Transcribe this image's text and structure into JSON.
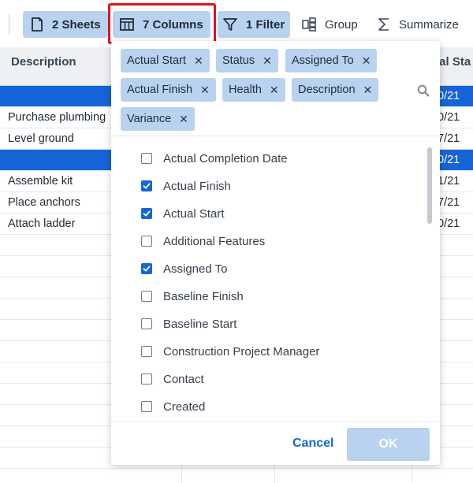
{
  "toolbar": {
    "sheets_label": "2 Sheets",
    "columns_label": "7 Columns",
    "filter_label": "1 Filter",
    "group_label": "Group",
    "summarize_label": "Summarize"
  },
  "grid": {
    "header_description": "Description",
    "header_right": "ual Sta",
    "rows": [
      {
        "desc": "",
        "right": "0/21",
        "selected": true
      },
      {
        "desc": "Purchase plumbing",
        "right": "0/21",
        "selected": false
      },
      {
        "desc": "Level ground",
        "right": "7/21",
        "selected": false
      },
      {
        "desc": "",
        "right": "0/21",
        "selected": true
      },
      {
        "desc": "Assemble kit",
        "right": "1/21",
        "selected": false
      },
      {
        "desc": "Place anchors",
        "right": "7/21",
        "selected": false
      },
      {
        "desc": "Attach ladder",
        "right": "0/21",
        "selected": false
      }
    ]
  },
  "panel": {
    "chips": [
      "Actual Start",
      "Status",
      "Assigned To",
      "Actual Finish",
      "Health",
      "Description",
      "Variance"
    ],
    "items": [
      {
        "label": "Actual Completion Date",
        "checked": false
      },
      {
        "label": "Actual Finish",
        "checked": true
      },
      {
        "label": "Actual Start",
        "checked": true
      },
      {
        "label": "Additional Features",
        "checked": false
      },
      {
        "label": "Assigned To",
        "checked": true
      },
      {
        "label": "Baseline Finish",
        "checked": false
      },
      {
        "label": "Baseline Start",
        "checked": false
      },
      {
        "label": "Construction Project Manager",
        "checked": false
      },
      {
        "label": "Contact",
        "checked": false
      },
      {
        "label": "Created",
        "checked": false
      }
    ],
    "cancel_label": "Cancel",
    "ok_label": "OK"
  },
  "colors": {
    "accent": "#1565d8",
    "chip_bg": "#b9d2ef",
    "highlight": "#e0141e"
  },
  "icons": [
    "sheet-icon",
    "columns-icon",
    "filter-icon",
    "group-icon",
    "summarize-icon",
    "search-icon",
    "close-icon",
    "checkmark-icon"
  ]
}
